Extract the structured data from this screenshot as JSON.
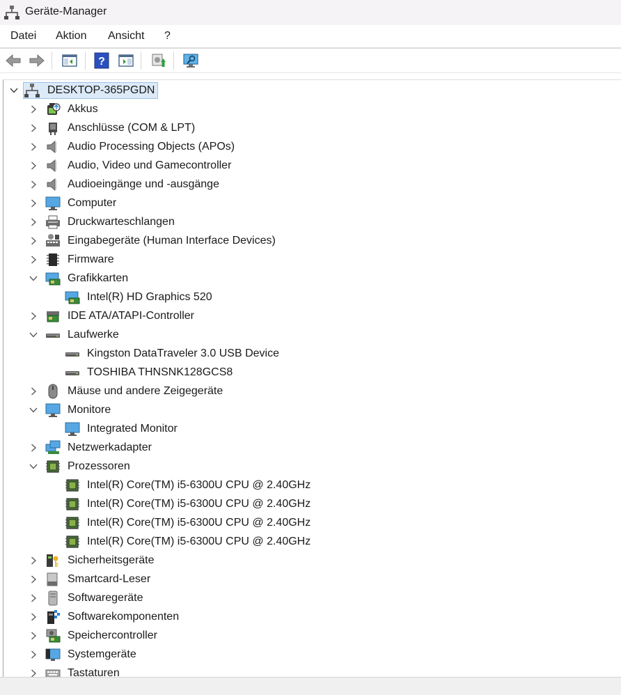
{
  "window": {
    "title": "Geräte-Manager"
  },
  "menu": [
    "Datei",
    "Aktion",
    "Ansicht",
    "?"
  ],
  "toolbar": [
    {
      "name": "back-icon"
    },
    {
      "name": "forward-icon"
    },
    {
      "name": "show-hide-tree-icon"
    },
    {
      "name": "help-icon"
    },
    {
      "name": "properties-icon"
    },
    {
      "name": "update-driver-icon"
    },
    {
      "name": "scan-hardware-icon"
    }
  ],
  "tree": {
    "root": "DESKTOP-365PGDN",
    "items": [
      {
        "label": "Akkus",
        "level": 1,
        "state": "collapsed",
        "icon": "battery"
      },
      {
        "label": "Anschlüsse (COM & LPT)",
        "level": 1,
        "state": "collapsed",
        "icon": "port"
      },
      {
        "label": "Audio Processing Objects (APOs)",
        "level": 1,
        "state": "collapsed",
        "icon": "speaker"
      },
      {
        "label": "Audio, Video und Gamecontroller",
        "level": 1,
        "state": "collapsed",
        "icon": "speaker"
      },
      {
        "label": "Audioeingänge und -ausgänge",
        "level": 1,
        "state": "collapsed",
        "icon": "speaker"
      },
      {
        "label": "Computer",
        "level": 1,
        "state": "collapsed",
        "icon": "monitor"
      },
      {
        "label": "Druckwarteschlangen",
        "level": 1,
        "state": "collapsed",
        "icon": "printer"
      },
      {
        "label": "Eingabegeräte (Human Interface Devices)",
        "level": 1,
        "state": "collapsed",
        "icon": "hid"
      },
      {
        "label": "Firmware",
        "level": 1,
        "state": "collapsed",
        "icon": "chip"
      },
      {
        "label": "Grafikkarten",
        "level": 1,
        "state": "expanded",
        "icon": "display-adapter"
      },
      {
        "label": "Intel(R) HD Graphics 520",
        "level": 2,
        "state": "leaf",
        "icon": "display-adapter"
      },
      {
        "label": "IDE ATA/ATAPI-Controller",
        "level": 1,
        "state": "collapsed",
        "icon": "ide"
      },
      {
        "label": "Laufwerke",
        "level": 1,
        "state": "expanded",
        "icon": "drive"
      },
      {
        "label": "Kingston DataTraveler 3.0 USB Device",
        "level": 2,
        "state": "leaf",
        "icon": "drive"
      },
      {
        "label": "TOSHIBA THNSNK128GCS8",
        "level": 2,
        "state": "leaf",
        "icon": "drive"
      },
      {
        "label": "Mäuse und andere Zeigegeräte",
        "level": 1,
        "state": "collapsed",
        "icon": "mouse"
      },
      {
        "label": "Monitore",
        "level": 1,
        "state": "expanded",
        "icon": "monitor"
      },
      {
        "label": "Integrated Monitor",
        "level": 2,
        "state": "leaf",
        "icon": "monitor"
      },
      {
        "label": "Netzwerkadapter",
        "level": 1,
        "state": "collapsed",
        "icon": "network"
      },
      {
        "label": "Prozessoren",
        "level": 1,
        "state": "expanded",
        "icon": "cpu"
      },
      {
        "label": "Intel(R) Core(TM) i5-6300U CPU @ 2.40GHz",
        "level": 2,
        "state": "leaf",
        "icon": "cpu"
      },
      {
        "label": "Intel(R) Core(TM) i5-6300U CPU @ 2.40GHz",
        "level": 2,
        "state": "leaf",
        "icon": "cpu"
      },
      {
        "label": "Intel(R) Core(TM) i5-6300U CPU @ 2.40GHz",
        "level": 2,
        "state": "leaf",
        "icon": "cpu"
      },
      {
        "label": "Intel(R) Core(TM) i5-6300U CPU @ 2.40GHz",
        "level": 2,
        "state": "leaf",
        "icon": "cpu"
      },
      {
        "label": "Sicherheitsgeräte",
        "level": 1,
        "state": "collapsed",
        "icon": "security"
      },
      {
        "label": "Smartcard-Leser",
        "level": 1,
        "state": "collapsed",
        "icon": "smartcard"
      },
      {
        "label": "Softwaregeräte",
        "level": 1,
        "state": "collapsed",
        "icon": "software-device"
      },
      {
        "label": "Softwarekomponenten",
        "level": 1,
        "state": "collapsed",
        "icon": "software-component"
      },
      {
        "label": "Speichercontroller",
        "level": 1,
        "state": "collapsed",
        "icon": "storage-controller"
      },
      {
        "label": "Systemgeräte",
        "level": 1,
        "state": "collapsed",
        "icon": "system"
      },
      {
        "label": "Tastaturen",
        "level": 1,
        "state": "collapsed",
        "icon": "keyboard"
      }
    ]
  },
  "colors": {
    "selection_bg": "#dceaf8",
    "selection_border": "#99c2ea",
    "chevron": "#5a5a5a"
  }
}
